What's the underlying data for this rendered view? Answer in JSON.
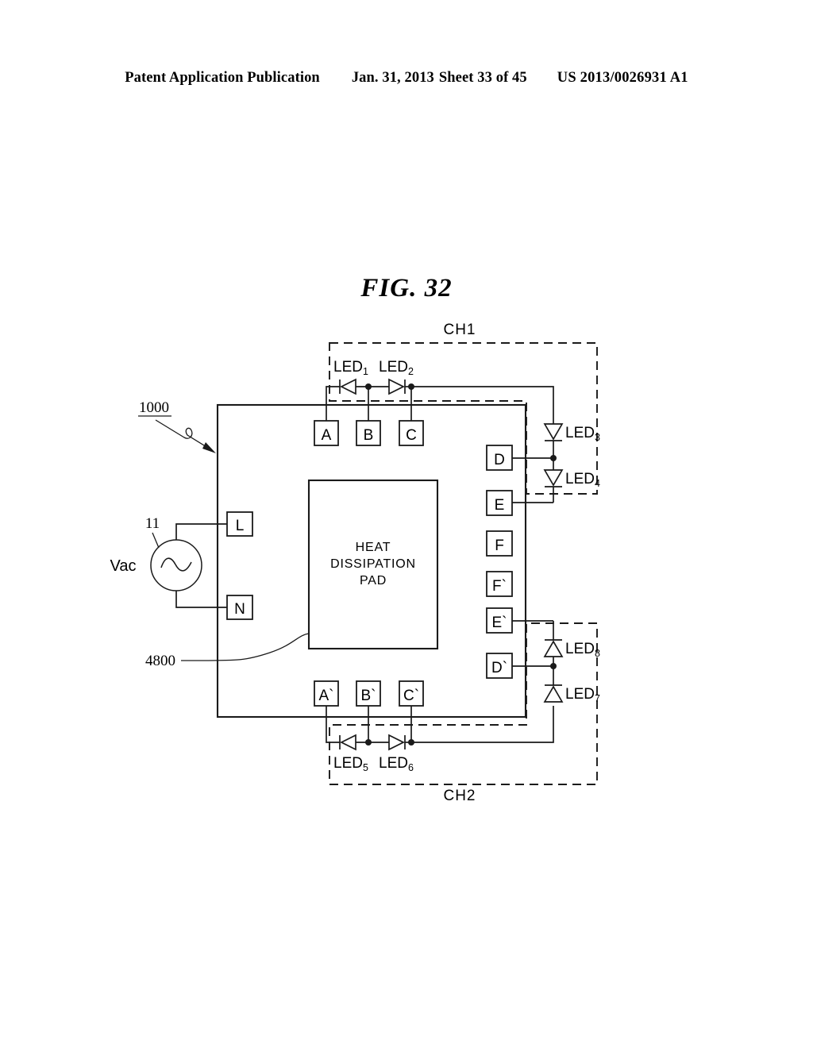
{
  "header": {
    "publication": "Patent Application Publication",
    "date": "Jan. 31, 2013",
    "sheet": "Sheet 33 of 45",
    "doc_number": "US 2013/0026931 A1"
  },
  "figure": {
    "title": "FIG. 32"
  },
  "diagram": {
    "device_ref": "1000",
    "pad_ref": "4800",
    "source_ref": "11",
    "source_label": "Vac",
    "pad_label_lines": [
      "HEAT",
      "DISSIPATION",
      "PAD"
    ],
    "channels": [
      {
        "id": "ch1",
        "label": "CH1"
      },
      {
        "id": "ch2",
        "label": "CH2"
      }
    ],
    "pins": {
      "top": [
        {
          "id": "pin-a",
          "label": "A"
        },
        {
          "id": "pin-b",
          "label": "B"
        },
        {
          "id": "pin-c",
          "label": "C"
        }
      ],
      "left": [
        {
          "id": "pin-l",
          "label": "L"
        },
        {
          "id": "pin-n",
          "label": "N"
        }
      ],
      "right": [
        {
          "id": "pin-d",
          "label": "D"
        },
        {
          "id": "pin-e",
          "label": "E"
        },
        {
          "id": "pin-f",
          "label": "F"
        },
        {
          "id": "pin-f-prime",
          "label": "F`"
        },
        {
          "id": "pin-e-prime",
          "label": "E`"
        },
        {
          "id": "pin-d-prime",
          "label": "D`"
        }
      ],
      "bottom": [
        {
          "id": "pin-a-prime",
          "label": "A`"
        },
        {
          "id": "pin-b-prime",
          "label": "B`"
        },
        {
          "id": "pin-c-prime",
          "label": "C`"
        }
      ]
    },
    "leds": [
      {
        "id": "led1",
        "base": "LED",
        "sub": "1"
      },
      {
        "id": "led2",
        "base": "LED",
        "sub": "2"
      },
      {
        "id": "led3",
        "base": "LED",
        "sub": "3"
      },
      {
        "id": "led4",
        "base": "LED",
        "sub": "4"
      },
      {
        "id": "led5",
        "base": "LED",
        "sub": "5"
      },
      {
        "id": "led6",
        "base": "LED",
        "sub": "6"
      },
      {
        "id": "led7",
        "base": "LED",
        "sub": "7"
      },
      {
        "id": "led8",
        "base": "LED",
        "sub": "8"
      }
    ]
  }
}
